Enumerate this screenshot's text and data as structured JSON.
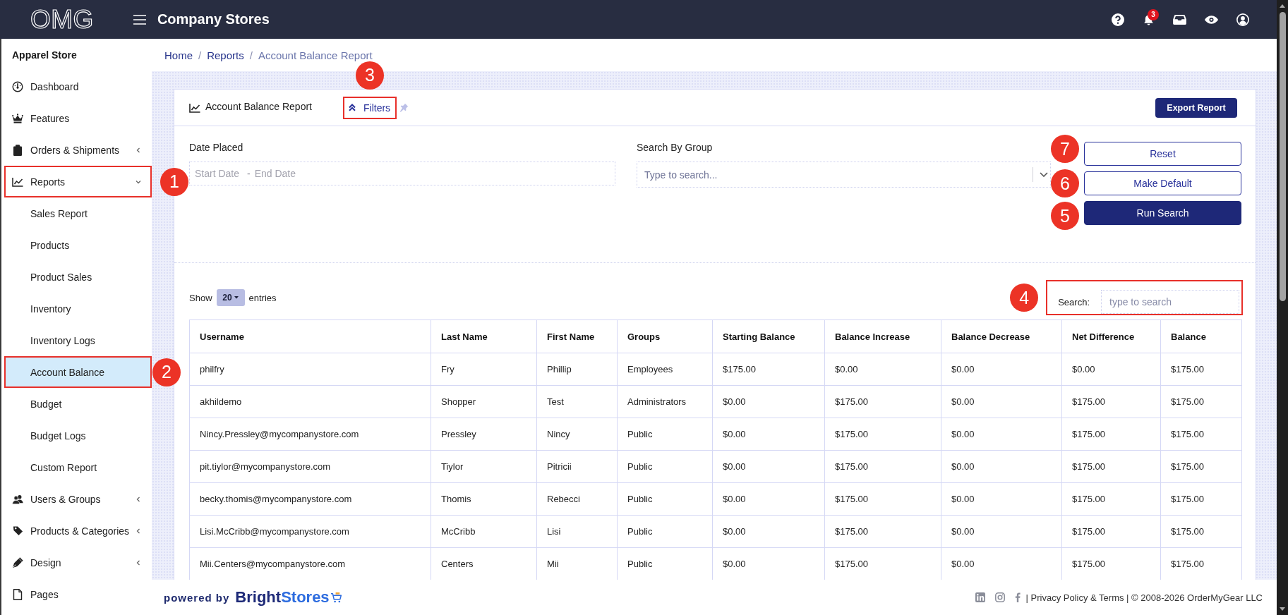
{
  "header": {
    "logo": "OMG",
    "title": "Company Stores",
    "notification_count": "3"
  },
  "sidebar": {
    "store": "Apparel Store",
    "items": [
      {
        "label": "Dashboard",
        "kind": "link",
        "selected": false
      },
      {
        "label": "Features",
        "kind": "link",
        "selected": false
      },
      {
        "label": "Orders & Shipments",
        "kind": "group",
        "expanded": false,
        "selected": false
      },
      {
        "label": "Reports",
        "kind": "group",
        "expanded": true,
        "selected": false,
        "callout": {
          "number": "1",
          "boxed": true
        },
        "children": [
          {
            "label": "Sales Report",
            "selected": false
          },
          {
            "label": "Products",
            "selected": false
          },
          {
            "label": "Product Sales",
            "selected": false
          },
          {
            "label": "Inventory",
            "selected": false
          },
          {
            "label": "Inventory Logs",
            "selected": false
          },
          {
            "label": "Account Balance",
            "selected": true,
            "callout": {
              "number": "2",
              "boxed": true
            }
          },
          {
            "label": "Budget",
            "selected": false
          },
          {
            "label": "Budget Logs",
            "selected": false
          },
          {
            "label": "Custom Report",
            "selected": false
          }
        ]
      },
      {
        "label": "Users & Groups",
        "kind": "group",
        "expanded": false,
        "selected": false
      },
      {
        "label": "Products & Categories",
        "kind": "group",
        "expanded": false,
        "selected": false
      },
      {
        "label": "Design",
        "kind": "group",
        "expanded": false,
        "selected": false
      },
      {
        "label": "Pages",
        "kind": "link",
        "selected": false
      }
    ]
  },
  "breadcrumb": {
    "items": [
      {
        "label": "Home",
        "current": false
      },
      {
        "label": "Reports",
        "current": false
      },
      {
        "label": "Account Balance Report",
        "current": true
      }
    ],
    "separators": [
      "/",
      "/"
    ]
  },
  "report": {
    "title": "Account Balance Report",
    "filters_toggle": {
      "label": "Filters",
      "expanded": true,
      "callout": {
        "number": "3",
        "boxed": true
      }
    },
    "pinned": false,
    "export_button": "Export Report"
  },
  "filters": {
    "date": {
      "label": "Date Placed",
      "start_placeholder": "Start Date",
      "separator": "-",
      "end_placeholder": "End Date"
    },
    "group": {
      "label": "Search By Group",
      "placeholder": "Type to search..."
    },
    "buttons": [
      {
        "label": "Reset",
        "kind": "outline",
        "callout": {
          "number": "7",
          "boxed": false
        }
      },
      {
        "label": "Make Default",
        "kind": "outline",
        "callout": {
          "number": "6",
          "boxed": false
        }
      },
      {
        "label": "Run Search",
        "kind": "primary",
        "callout": {
          "number": "5",
          "boxed": false
        }
      }
    ]
  },
  "table_controls": {
    "show_label": "Show",
    "page_size": "20",
    "entries_label": "entries",
    "search": {
      "label": "Search:",
      "placeholder": "type to search",
      "callout": {
        "number": "4",
        "boxed": true
      }
    }
  },
  "table": {
    "columns": [
      "Username",
      "Last Name",
      "First Name",
      "Groups",
      "Starting Balance",
      "Balance Increase",
      "Balance Decrease",
      "Net Difference",
      "Balance"
    ],
    "rows": [
      [
        "philfry",
        "Fry",
        "Phillip",
        "Employees",
        "$175.00",
        "$0.00",
        "$0.00",
        "$0.00",
        "$175.00"
      ],
      [
        "akhildemo",
        "Shopper",
        "Test",
        "Administrators",
        "$0.00",
        "$175.00",
        "$0.00",
        "$175.00",
        "$175.00"
      ],
      [
        "Nincy.Pressley@mycompanystore.com",
        "Pressley",
        "Nincy",
        "Public",
        "$0.00",
        "$175.00",
        "$0.00",
        "$175.00",
        "$175.00"
      ],
      [
        "pit.tiylor@mycompanystore.com",
        "Tiylor",
        "Pitricii",
        "Public",
        "$0.00",
        "$175.00",
        "$0.00",
        "$175.00",
        "$175.00"
      ],
      [
        "becky.thomis@mycompanystore.com",
        "Thomis",
        "Rebecci",
        "Public",
        "$0.00",
        "$175.00",
        "$0.00",
        "$175.00",
        "$175.00"
      ],
      [
        "Lisi.McCribb@mycompanystore.com",
        "McCribb",
        "Lisi",
        "Public",
        "$0.00",
        "$175.00",
        "$0.00",
        "$175.00",
        "$175.00"
      ],
      [
        "Mii.Centers@mycompanystore.com",
        "Centers",
        "Mii",
        "Public",
        "$0.00",
        "$175.00",
        "$0.00",
        "$175.00",
        "$175.00"
      ]
    ]
  },
  "footer": {
    "powered_by": "powered by",
    "brand": {
      "first": "Bright",
      "second": "Stores"
    },
    "legal": "| Privacy Policy & Terms | © 2008-2026 OrderMyGear LLC"
  }
}
